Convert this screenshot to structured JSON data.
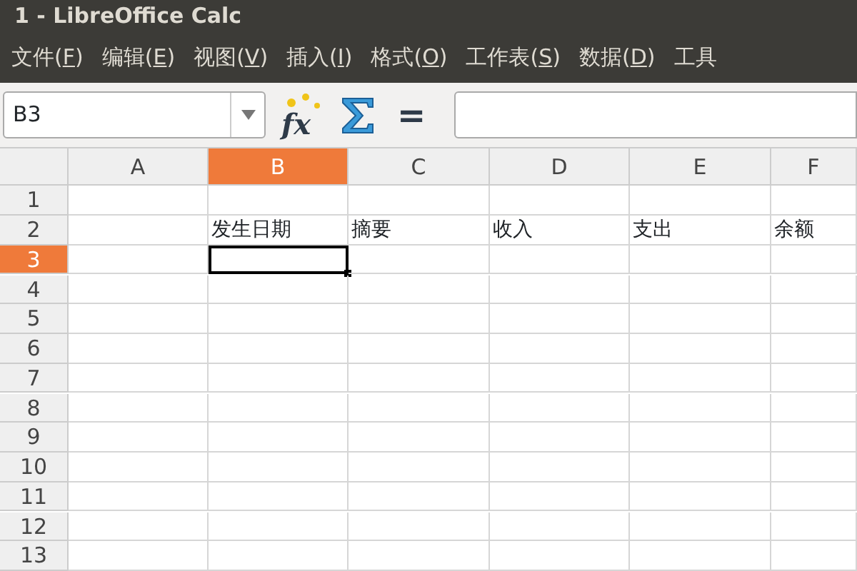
{
  "window": {
    "title": "1 - LibreOffice Calc"
  },
  "menu": [
    {
      "before": "文件(",
      "key": "F",
      "after": ")"
    },
    {
      "before": "编辑(",
      "key": "E",
      "after": ")"
    },
    {
      "before": "视图(",
      "key": "V",
      "after": ")"
    },
    {
      "before": "插入(",
      "key": "I",
      "after": ")"
    },
    {
      "before": "格式(",
      "key": "O",
      "after": ")"
    },
    {
      "before": "工作表(",
      "key": "S",
      "after": ")"
    },
    {
      "before": "数据(",
      "key": "D",
      "after": ")"
    },
    {
      "before": "工具"
    }
  ],
  "toolbar": {
    "name_box": "B3",
    "function_wizard": "fx",
    "equals": "="
  },
  "sheet": {
    "columns": [
      {
        "label": "A",
        "selected": false
      },
      {
        "label": "B",
        "selected": true
      },
      {
        "label": "C",
        "selected": false
      },
      {
        "label": "D",
        "selected": false
      },
      {
        "label": "E",
        "selected": false
      },
      {
        "label": "F",
        "selected": false
      }
    ],
    "rows": [
      {
        "label": "1",
        "selected": false,
        "cells": [
          "",
          "",
          "",
          "",
          "",
          ""
        ]
      },
      {
        "label": "2",
        "selected": false,
        "cells": [
          "",
          "发生日期",
          "摘要",
          "收入",
          "支出",
          "余额"
        ]
      },
      {
        "label": "3",
        "selected": true,
        "cells": [
          "",
          "",
          "",
          "",
          "",
          ""
        ]
      },
      {
        "label": "4",
        "selected": false,
        "cells": [
          "",
          "",
          "",
          "",
          "",
          ""
        ]
      },
      {
        "label": "5",
        "selected": false,
        "cells": [
          "",
          "",
          "",
          "",
          "",
          ""
        ]
      },
      {
        "label": "6",
        "selected": false,
        "cells": [
          "",
          "",
          "",
          "",
          "",
          ""
        ]
      },
      {
        "label": "7",
        "selected": false,
        "cells": [
          "",
          "",
          "",
          "",
          "",
          ""
        ]
      },
      {
        "label": "8",
        "selected": false,
        "cells": [
          "",
          "",
          "",
          "",
          "",
          ""
        ]
      },
      {
        "label": "9",
        "selected": false,
        "cells": [
          "",
          "",
          "",
          "",
          "",
          ""
        ]
      },
      {
        "label": "10",
        "selected": false,
        "cells": [
          "",
          "",
          "",
          "",
          "",
          ""
        ]
      },
      {
        "label": "11",
        "selected": false,
        "cells": [
          "",
          "",
          "",
          "",
          "",
          ""
        ]
      },
      {
        "label": "12",
        "selected": false,
        "cells": [
          "",
          "",
          "",
          "",
          "",
          ""
        ]
      },
      {
        "label": "13",
        "selected": false,
        "cells": [
          "",
          "",
          "",
          "",
          "",
          ""
        ]
      }
    ]
  }
}
